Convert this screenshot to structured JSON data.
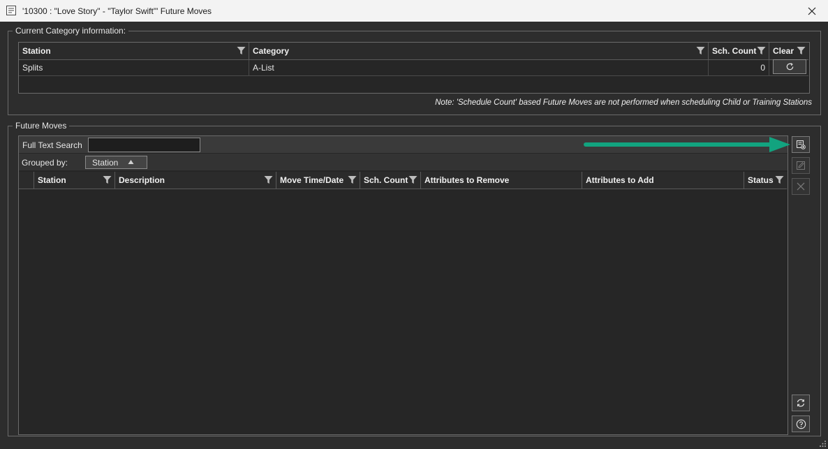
{
  "window": {
    "title": "'10300 : \"Love Story\" - \"Taylor Swift\"' Future Moves"
  },
  "current_category": {
    "legend": "Current Category information:",
    "columns": [
      "Station",
      "Category",
      "Sch. Count",
      "Clear"
    ],
    "row": {
      "station": "Splits",
      "category": "A-List",
      "sch_count": "0"
    },
    "note": "Note: 'Schedule Count' based Future Moves are not performed when scheduling Child or Training Stations"
  },
  "future_moves": {
    "legend": "Future Moves",
    "search_label": "Full Text Search",
    "search_value": "",
    "grouped_by_label": "Grouped by:",
    "grouped_by_value": "Station",
    "columns": [
      "Station",
      "Description",
      "Move Time/Date",
      "Sch. Count",
      "Attributes to Remove",
      "Attributes to Add",
      "Status"
    ]
  },
  "colors": {
    "accent_arrow": "#12a37f",
    "background": "#2d2d2d",
    "grid": "#262626"
  }
}
